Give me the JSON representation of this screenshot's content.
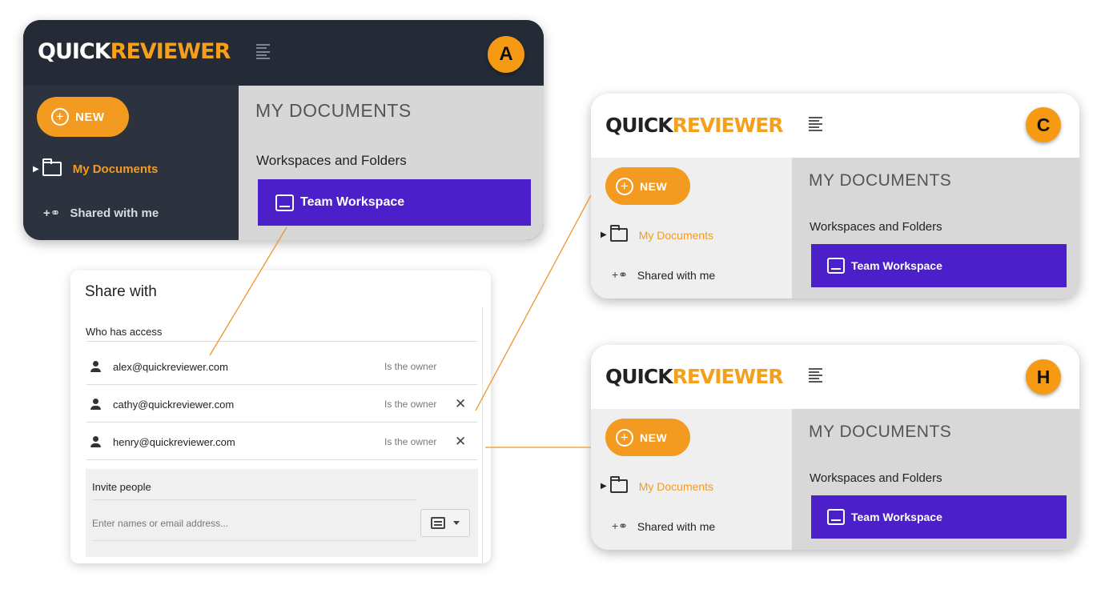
{
  "app": {
    "logo_part1": "QUICK",
    "logo_part2": "REVIEWER"
  },
  "panels": {
    "a": {
      "badge": "A"
    },
    "c": {
      "badge": "C"
    },
    "h": {
      "badge": "H"
    }
  },
  "sidebar": {
    "new_label": "NEW",
    "my_documents": "My Documents",
    "shared_with_me": "Shared with me"
  },
  "main": {
    "title": "MY DOCUMENTS",
    "section": "Workspaces and Folders",
    "workspace": "Team Workspace"
  },
  "share_dialog": {
    "title": "Share with",
    "who_has_access": "Who has access",
    "people": [
      {
        "email": "alex@quickreviewer.com",
        "role": "Is the owner",
        "removable": false
      },
      {
        "email": "cathy@quickreviewer.com",
        "role": "Is the owner",
        "removable": true
      },
      {
        "email": "henry@quickreviewer.com",
        "role": "Is the owner",
        "removable": true
      }
    ],
    "remove_symbol": "✕",
    "invite_label": "Invite people",
    "invite_placeholder": "Enter names or email address..."
  },
  "colors": {
    "accent": "#f29b20",
    "workspace": "#4b1fc9",
    "dark_header": "#242b37",
    "connector": "#f0952a"
  }
}
